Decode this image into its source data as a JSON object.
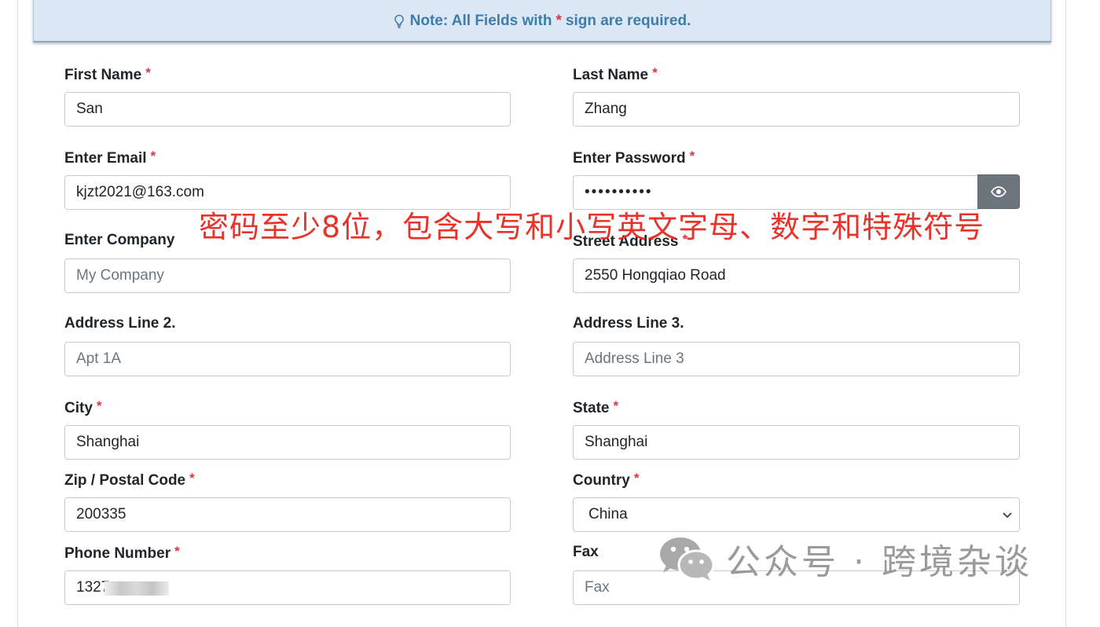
{
  "note": {
    "prefix": "Note: All Fields with",
    "star": "*",
    "suffix": "sign are required."
  },
  "required_marker": "*",
  "fields": {
    "first_name": {
      "label": "First Name",
      "value": "San"
    },
    "last_name": {
      "label": "Last Name",
      "value": "Zhang"
    },
    "email": {
      "label": "Enter Email",
      "value": "kjzt2021@163.com"
    },
    "password": {
      "label": "Enter Password",
      "value": "••••••••••"
    },
    "company": {
      "label": "Enter Company",
      "placeholder": "My Company"
    },
    "street": {
      "label": "Street Address",
      "value": "2550 Hongqiao Road"
    },
    "address2": {
      "label": "Address Line 2.",
      "placeholder": "Apt 1A"
    },
    "address3": {
      "label": "Address Line 3.",
      "placeholder": "Address Line 3"
    },
    "city": {
      "label": "City",
      "value": "Shanghai"
    },
    "state": {
      "label": "State",
      "value": "Shanghai"
    },
    "zip": {
      "label": "Zip / Postal Code",
      "value": "200335"
    },
    "country": {
      "label": "Country",
      "value": "China"
    },
    "phone": {
      "label": "Phone Number",
      "value": "1327"
    },
    "fax": {
      "label": "Fax",
      "placeholder": "Fax"
    }
  },
  "annotation": "密码至少8位，包含大写和小写英文字母、数字和特殊符号",
  "watermark": "公众号 · 跨境杂谈",
  "colors": {
    "required": "#dc3545",
    "note_text": "#3f7caa",
    "note_bg": "#dbe8f4",
    "annotation": "#e8332a",
    "eye_button": "#6c757d"
  },
  "icons": {
    "note": "lightbulb-icon",
    "password_toggle": "eye-icon",
    "select": "chevron-down-icon",
    "watermark": "wechat-icon"
  }
}
